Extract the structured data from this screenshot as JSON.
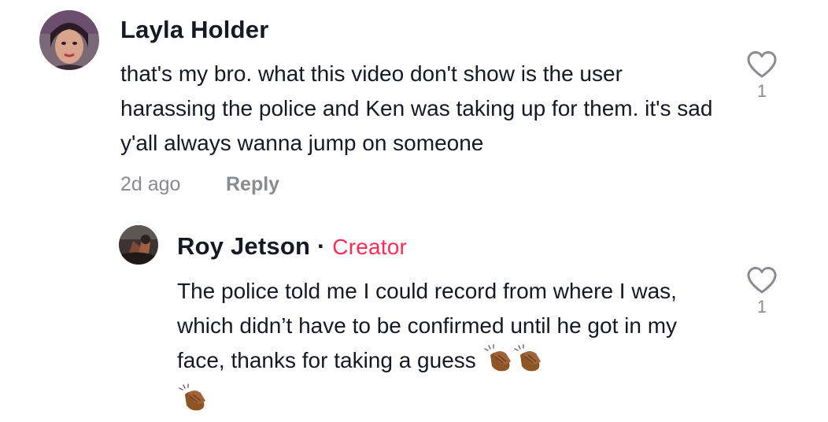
{
  "comments": [
    {
      "username": "Layla Holder",
      "text": "that's my bro. what this video don't show is the user harassing the police and Ken was taking up for them. it's sad y'all always wanna jump on someone",
      "time": "2d ago",
      "reply_label": "Reply",
      "likes": "1",
      "like_icon": "heart-outline-icon"
    }
  ],
  "replies": [
    {
      "username": "Roy Jetson",
      "separator": "·",
      "badge": "Creator",
      "text": "The police told me I could record from where I was, which didn’t have to be confirmed until he got in my face, thanks for taking a guess",
      "emoji_names": [
        "clapping-hands-icon",
        "clapping-hands-icon",
        "clapping-hands-icon"
      ],
      "likes": "1",
      "like_icon": "heart-outline-icon"
    }
  ],
  "colors": {
    "text": "#161823",
    "muted": "#8a8b91",
    "creator": "#fe2c55",
    "emoji": "#8d5524"
  }
}
